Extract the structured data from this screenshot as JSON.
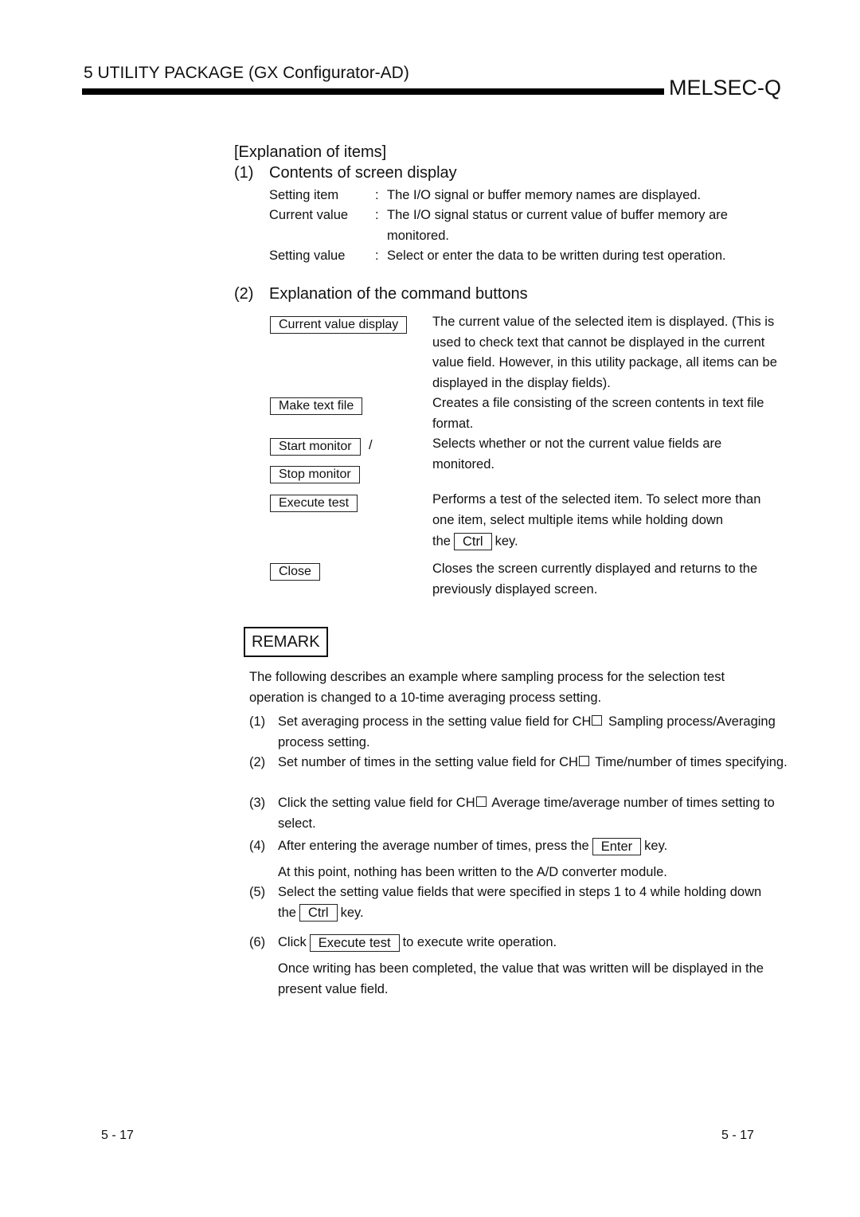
{
  "header": {
    "chapter_title": "5   UTILITY PACKAGE (GX Configurator-AD)",
    "brand": "MELSEC-Q"
  },
  "explanation": {
    "heading": "[Explanation of items]",
    "section1": {
      "num": "(1)",
      "title": "Contents of screen display",
      "items": [
        {
          "label": "Setting item",
          "colon": ":",
          "desc": "The I/O signal or buffer memory names are displayed."
        },
        {
          "label": "Current value",
          "colon": ":",
          "desc": "The I/O signal status or current value of buffer memory are",
          "desc2": "monitored."
        },
        {
          "label": "Setting value",
          "colon": ":",
          "desc": "Select or enter the data to be written during test operation."
        }
      ]
    },
    "section2": {
      "num": "(2)",
      "title": "Explanation of the command buttons",
      "buttons": [
        {
          "label": "Current value display",
          "desc": "The current value of the selected item is displayed. (This is used to check text that cannot be displayed in the current value field. However, in this utility package, all items can be displayed in the display fields)."
        },
        {
          "label": "Make text file",
          "desc": "Creates a file consisting of the screen contents in text file format."
        },
        {
          "label": "Start monitor",
          "separator": "/",
          "label2": "Stop monitor",
          "desc": "Selects whether or not the current value fields are monitored."
        },
        {
          "label": "Execute test",
          "desc": "Performs a test of the selected item. To select more than one item, select multiple items while holding down",
          "desc_pre": "the",
          "key": "Ctrl",
          "desc_post": "key."
        },
        {
          "label": "Close",
          "desc": "Closes the screen currently displayed and returns to the previously displayed screen."
        }
      ]
    }
  },
  "remark": {
    "label": "REMARK",
    "intro": "The following describes an example where sampling process for the selection test operation is changed to a 10-time averaging process setting.",
    "steps": [
      {
        "num": "(1)",
        "pre": "Set averaging process in the setting value field for CH",
        "post": " Sampling process/Averaging process setting."
      },
      {
        "num": "(2)",
        "pre": "Set number of times in the setting value field for CH",
        "post": " Time/number of times specifying."
      },
      {
        "num": "(3)",
        "pre": "Click the setting value field for CH",
        "post": " Average time/average number of times setting to select."
      },
      {
        "num": "(4)",
        "pre": "After entering the average number of times, press the",
        "key": "Enter",
        "post": "key.",
        "note": "At this point, nothing has been written to the A/D converter module."
      },
      {
        "num": "(5)",
        "pre": "Select the setting value fields that were specified in steps 1 to 4 while holding down the",
        "key": "Ctrl",
        "post": "key."
      },
      {
        "num": "(6)",
        "pre": "Click",
        "key": "Execute test",
        "post": "to execute write operation.",
        "note": "Once writing has been completed, the value that was written will be displayed in the present value field."
      }
    ]
  },
  "footer": {
    "page_left": "5 - 17",
    "page_right": "5 - 17"
  }
}
